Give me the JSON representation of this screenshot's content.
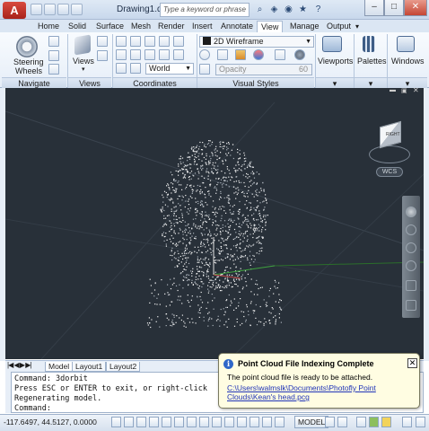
{
  "titlebar": {
    "app_logo": "A",
    "document_title": "Drawing1.dwg",
    "search_placeholder": "Type a keyword or phrase",
    "buttons": {
      "minimize": "–",
      "maximize": "□",
      "close": "✕"
    }
  },
  "ribbon": {
    "tabs": [
      "Home",
      "Solid",
      "Surface",
      "Mesh",
      "Render",
      "Insert",
      "Annotate",
      "View",
      "Manage",
      "Output"
    ],
    "active_tab": "View",
    "panels": {
      "navigate": {
        "title": "Navigate",
        "steering_label": "Steering",
        "wheels_label": "Wheels"
      },
      "views": {
        "title": "Views",
        "label": "Views"
      },
      "coordinates": {
        "title": "Coordinates",
        "ucs_combo": "World"
      },
      "visual_styles": {
        "title": "Visual Styles",
        "style_combo": "2D Wireframe",
        "opacity_label": "Opacity",
        "opacity_value": "60"
      },
      "viewports": {
        "label": "Viewports"
      },
      "palettes": {
        "label": "Palettes"
      },
      "windows": {
        "label": "Windows"
      }
    }
  },
  "viewport": {
    "wcs_label": "WCS",
    "viewcube_face": "RIGHT"
  },
  "layout_tabs": [
    "Model",
    "Layout1",
    "Layout2"
  ],
  "command_line": {
    "lines": [
      "Command: 3dorbit",
      "Press ESC or ENTER to exit, or right-click",
      "Regenerating model.",
      "Command:"
    ]
  },
  "status_bar": {
    "coordinates": "-117.6497, 44.5127, 0.0000",
    "model_button": "MODEL"
  },
  "notification": {
    "title": "Point Cloud File Indexing Complete",
    "message": "The point cloud file is ready to be attached.",
    "link": "C:\\Users\\walmslk\\Documents\\Photofly Point Clouds\\Kean's head.pcg",
    "close": "✕"
  },
  "colors": {
    "viewport_bg": "#283039",
    "ribbon_bg": "#e6eef8",
    "balloon_bg": "#fffde2",
    "link": "#1f33b8"
  }
}
